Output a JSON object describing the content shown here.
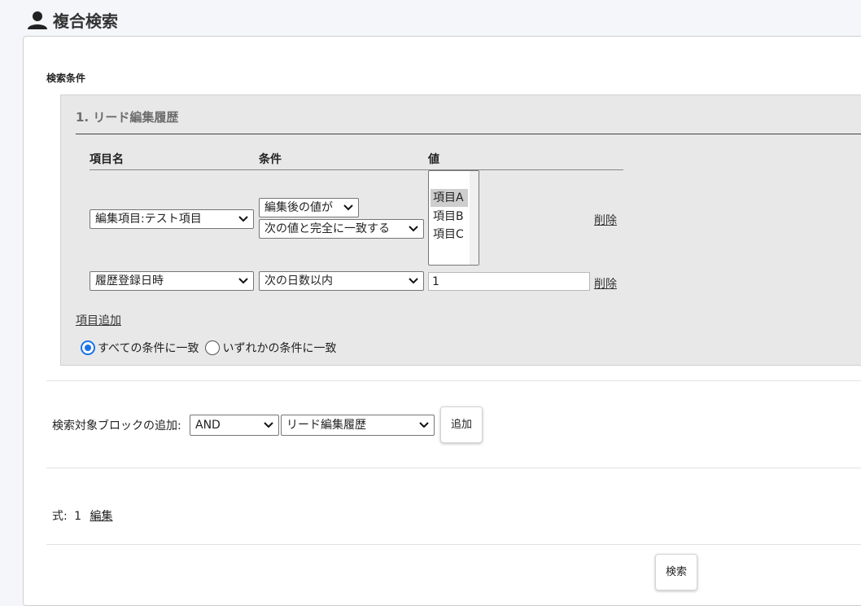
{
  "header": {
    "title": "複合検索"
  },
  "search_conditions": {
    "label": "検索条件",
    "block": {
      "title": "1. リード編集履歴",
      "columns": [
        "項目名",
        "条件",
        "値"
      ],
      "rows": [
        {
          "field": "編集項目:テスト項目",
          "condition_top": "編集後の値が",
          "condition": "次の値と完全に一致する",
          "values": [
            "項目A",
            "項目B",
            "項目C"
          ],
          "selected_value": "項目A",
          "delete": "削除"
        },
        {
          "field": "履歴登録日時",
          "condition": "次の日数以内",
          "value": "1",
          "delete": "削除"
        }
      ],
      "add_item": "項目追加",
      "match_all": "すべての条件に一致",
      "match_any": "いずれかの条件に一致",
      "match_mode": "all"
    }
  },
  "add_block": {
    "label": "検索対象ブロックの追加:",
    "operator": "AND",
    "target": "リード編集履歴",
    "button": "追加"
  },
  "expression": {
    "label": "式:",
    "value": "1",
    "edit": "編集"
  },
  "search_button": "検索",
  "colors": {
    "block_bg": "#e8e8e8",
    "radio_accent": "#1a73e8"
  }
}
